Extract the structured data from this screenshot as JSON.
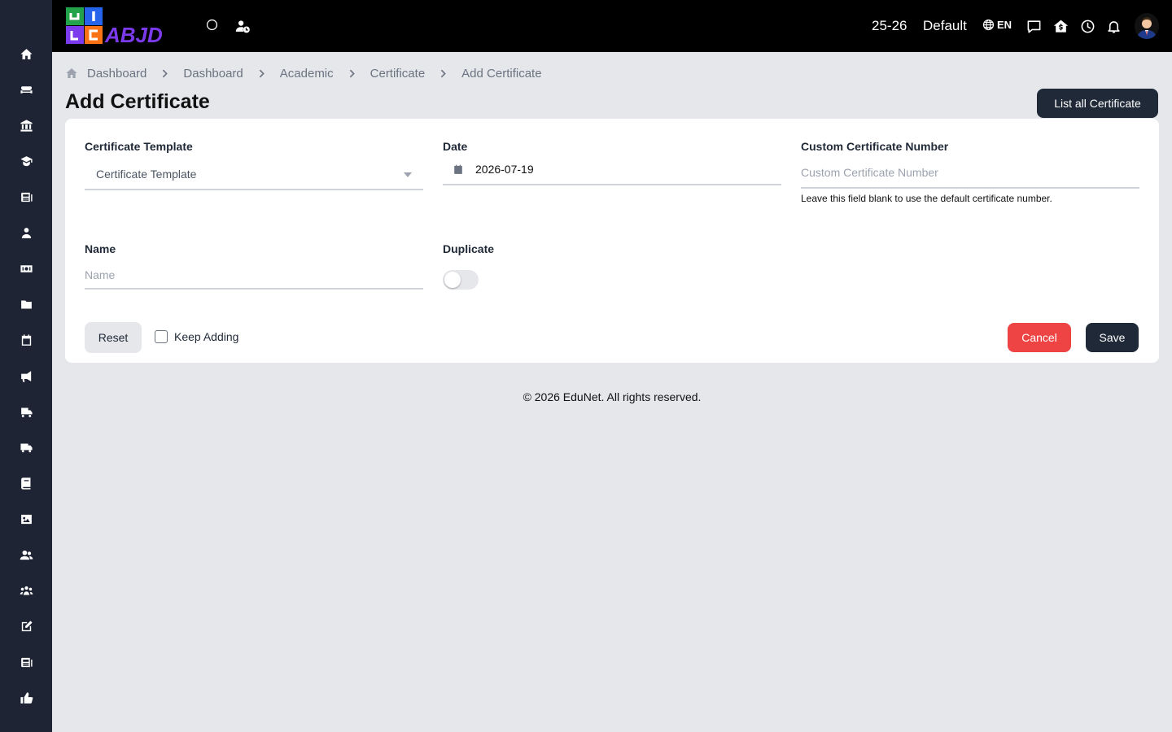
{
  "topbar": {
    "session": "25-26",
    "branch": "Default",
    "language": "EN",
    "icons": [
      "loading-circle-icon",
      "user-clock-icon",
      "globe-icon",
      "message-icon",
      "home-icon",
      "clock-icon",
      "bell-icon"
    ]
  },
  "sidebar": {
    "icons": [
      "home-icon",
      "sofa-icon",
      "bank-icon",
      "graduate-icon",
      "newspaper-icon",
      "user-tie-icon",
      "money-icon",
      "folder-icon",
      "calendar-icon",
      "megaphone-icon",
      "school-bus-icon",
      "truck-icon",
      "book-icon",
      "image-icon",
      "users-icon",
      "people-group-icon",
      "edit-icon",
      "news-icon",
      "thumbs-up-icon"
    ]
  },
  "breadcrumb": {
    "items": [
      "Dashboard",
      "Dashboard",
      "Academic",
      "Certificate",
      "Add Certificate"
    ]
  },
  "page": {
    "title": "Add Certificate",
    "list_button": "List all Certificate"
  },
  "form": {
    "template": {
      "label": "Certificate Template",
      "placeholder": "Certificate Template"
    },
    "date": {
      "label": "Date",
      "value": "2026-07-19"
    },
    "custom_number": {
      "label": "Custom Certificate Number",
      "placeholder": "Custom Certificate Number",
      "helper": "Leave this field blank to use the default certificate number."
    },
    "name": {
      "label": "Name",
      "placeholder": "Name"
    },
    "duplicate": {
      "label": "Duplicate",
      "on": false
    },
    "reset_button": "Reset",
    "keep_adding": "Keep Adding",
    "cancel_button": "Cancel",
    "save_button": "Save"
  },
  "footer": {
    "text": "© 2026 EduNet. All rights reserved."
  },
  "colors": {
    "sidebar_bg": "#1e2433",
    "topbar_bg": "#000000",
    "primary_dark": "#1f2937",
    "danger": "#ef4444",
    "page_bg": "#e5e7eb"
  }
}
